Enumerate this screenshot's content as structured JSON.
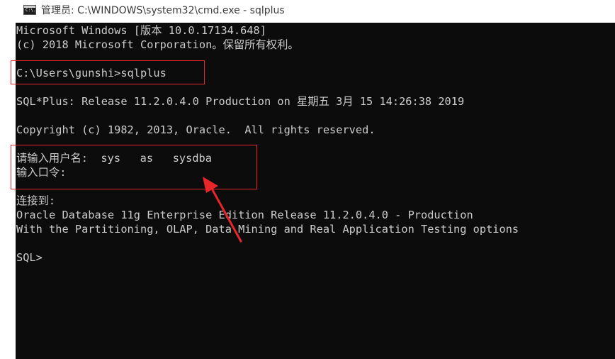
{
  "window": {
    "title": "管理员: C:\\WINDOWS\\system32\\cmd.exe - sqlplus",
    "icon": "cmd-console-icon",
    "icon_glyph": "C:\\."
  },
  "console": {
    "background": "#0c0c0c",
    "text_color": "#cccccc",
    "lines": {
      "l1": "Microsoft Windows [版本 10.0.17134.648]",
      "l2": "(c) 2018 Microsoft Corporation。保留所有权利。",
      "l3": "C:\\Users\\gunshi>sqlplus",
      "l4": "SQL*Plus: Release 11.2.0.4.0 Production on 星期五 3月 15 14:26:38 2019",
      "l5": "Copyright (c) 1982, 2013, Oracle.  All rights reserved.",
      "l6": "请输入用户名:  sys   as   sysdba",
      "l7": "输入口令:",
      "l8": "连接到:",
      "l9": "Oracle Database 11g Enterprise Edition Release 11.2.0.4.0 - Production",
      "l10": "With the Partitioning, OLAP, Data Mining and Real Application Testing options",
      "l11": "SQL>"
    }
  },
  "annotations": {
    "highlight_color": "#e8262a"
  }
}
